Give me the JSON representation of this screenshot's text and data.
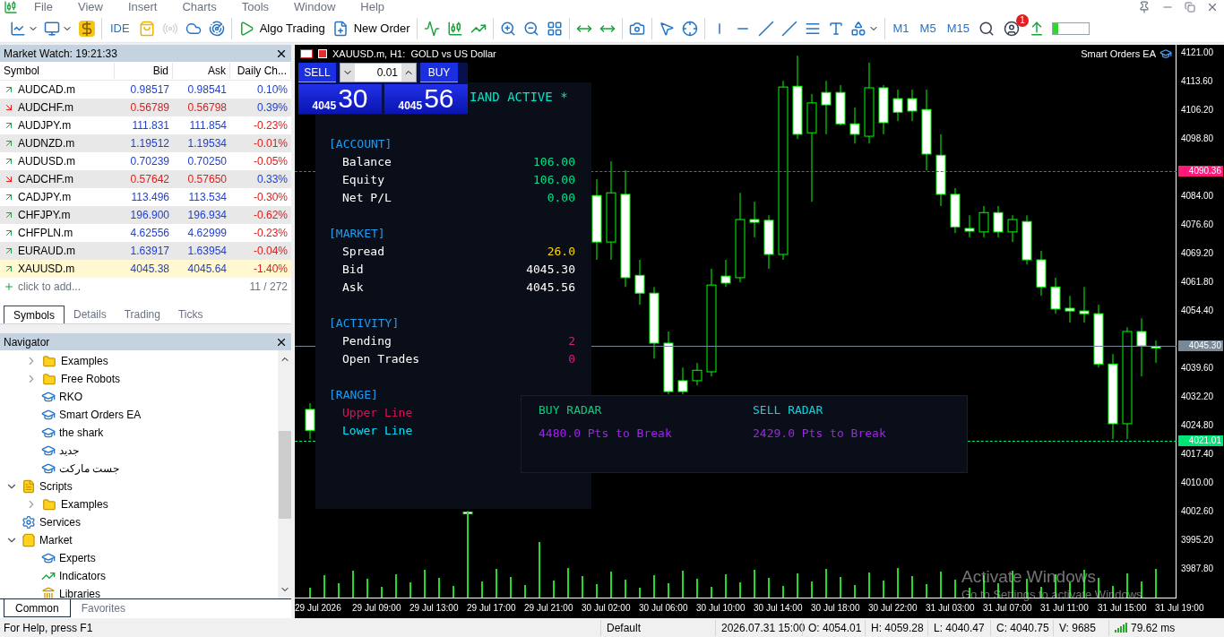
{
  "menu": [
    "File",
    "View",
    "Insert",
    "Charts",
    "Tools",
    "Window",
    "Help"
  ],
  "toolbar": {
    "ide": "IDE",
    "algo_trading": "Algo Trading",
    "new_order": "New Order",
    "timeframes": [
      "M1",
      "M5",
      "M15"
    ],
    "notification_count": "1"
  },
  "market_watch": {
    "title": "Market Watch: 19:21:33",
    "columns": [
      "Symbol",
      "Bid",
      "Ask",
      "Daily Ch..."
    ],
    "rows": [
      {
        "symbol": "AUDCAD.m",
        "bid": "0.98517",
        "ask": "0.98541",
        "change": "0.10%",
        "rising": true,
        "change_positive": true,
        "selected": false
      },
      {
        "symbol": "AUDCHF.m",
        "bid": "0.56789",
        "ask": "0.56798",
        "change": "0.39%",
        "rising": false,
        "change_positive": true,
        "selected": false
      },
      {
        "symbol": "AUDJPY.m",
        "bid": "111.831",
        "ask": "111.854",
        "change": "-0.23%",
        "rising": true,
        "change_positive": false,
        "selected": false
      },
      {
        "symbol": "AUDNZD.m",
        "bid": "1.19512",
        "ask": "1.19534",
        "change": "-0.01%",
        "rising": true,
        "change_positive": false,
        "selected": false
      },
      {
        "symbol": "AUDUSD.m",
        "bid": "0.70239",
        "ask": "0.70250",
        "change": "-0.05%",
        "rising": true,
        "change_positive": false,
        "selected": false
      },
      {
        "symbol": "CADCHF.m",
        "bid": "0.57642",
        "ask": "0.57650",
        "change": "0.33%",
        "rising": false,
        "change_positive": true,
        "selected": false
      },
      {
        "symbol": "CADJPY.m",
        "bid": "113.496",
        "ask": "113.534",
        "change": "-0.30%",
        "rising": true,
        "change_positive": false,
        "selected": false
      },
      {
        "symbol": "CHFJPY.m",
        "bid": "196.900",
        "ask": "196.934",
        "change": "-0.62%",
        "rising": true,
        "change_positive": false,
        "selected": false
      },
      {
        "symbol": "CHFPLN.m",
        "bid": "4.62556",
        "ask": "4.62999",
        "change": "-0.23%",
        "rising": true,
        "change_positive": false,
        "selected": false
      },
      {
        "symbol": "EURAUD.m",
        "bid": "1.63917",
        "ask": "1.63954",
        "change": "-0.04%",
        "rising": true,
        "change_positive": false,
        "selected": false
      },
      {
        "symbol": "XAUUSD.m",
        "bid": "4045.38",
        "ask": "4045.64",
        "change": "-1.40%",
        "rising": true,
        "change_positive": false,
        "selected": true
      }
    ],
    "add_hint": "click to add...",
    "count": "11 / 272",
    "tabs": [
      {
        "label": "Symbols",
        "selected": true
      },
      {
        "label": "Details",
        "selected": false
      },
      {
        "label": "Trading",
        "selected": false
      },
      {
        "label": "Ticks",
        "selected": false
      }
    ]
  },
  "navigator": {
    "title": "Navigator",
    "tree": [
      {
        "kind": "group",
        "children": [
          {
            "label": "Examples",
            "kind": "folder",
            "expanded": false
          },
          {
            "label": "Free Robots",
            "kind": "folder",
            "expanded": false
          },
          {
            "label": "RKO",
            "kind": "expert"
          },
          {
            "label": "Smart Orders EA",
            "kind": "expert"
          },
          {
            "label": "the shark",
            "kind": "expert"
          },
          {
            "label": "جديد",
            "kind": "expert"
          },
          {
            "label": "جست ماركت",
            "kind": "expert"
          }
        ]
      },
      {
        "label": "Scripts",
        "kind": "scripts",
        "expanded": true,
        "children": [
          {
            "label": "Examples",
            "kind": "folder",
            "expanded": false
          }
        ]
      },
      {
        "label": "Services",
        "kind": "services"
      },
      {
        "label": "Market",
        "kind": "market",
        "expanded": true,
        "children": [
          {
            "label": "Experts",
            "kind": "expert"
          },
          {
            "label": "Indicators",
            "kind": "indicator"
          },
          {
            "label": "Libraries",
            "kind": "library"
          }
        ]
      }
    ],
    "tabs": [
      {
        "label": "Common",
        "selected": true
      },
      {
        "label": "Favorites",
        "selected": false
      }
    ]
  },
  "chart": {
    "title": "XAUUSD.m, H1:  GOLD vs US Dollar",
    "expert": "Smart Orders EA",
    "chart_data": {
      "type": "candlestick",
      "ylim": [
        3980.2,
        4123.1
      ],
      "categories": [
        null,
        null,
        "29 Jul 2026",
        null,
        null,
        null,
        "29 Jul 09:00",
        null,
        null,
        null,
        "29 Jul 13:00",
        null,
        null,
        null,
        "29 Jul 17:00",
        null,
        null,
        null,
        "29 Jul 21:00",
        null,
        null,
        null,
        "30 Jul 02:00",
        null,
        null,
        null,
        "30 Jul 06:00",
        null,
        null,
        null,
        "30 Jul 10:00",
        null,
        null,
        null,
        "30 Jul 14:00",
        null,
        null,
        null,
        "30 Jul 18:00",
        null,
        null,
        null,
        "30 Jul 22:00",
        null,
        null,
        null,
        "31 Jul 03:00",
        null,
        null,
        null,
        "31 Jul 07:00",
        null,
        null,
        null,
        "31 Jul 11:00",
        null,
        null,
        null,
        "31 Jul 15:00",
        null,
        null,
        null,
        "31 Jul 19:00"
      ],
      "ohlc": [
        null,
        [
          4029.0,
          4030.6,
          4021.3,
          4023.6
        ],
        null,
        null,
        null,
        null,
        null,
        null,
        null,
        null,
        null,
        null,
        [
          4002.5,
          4002.8,
          3995.9,
          4002.2
        ],
        null,
        null,
        null,
        null,
        null,
        null,
        null,
        null,
        [
          4084.2,
          4088.4,
          4067.6,
          4072.2
        ],
        [
          4072.2,
          4093.0,
          4067.6,
          4084.9
        ],
        [
          4084.5,
          4090.7,
          4060.6,
          4063.0
        ],
        [
          4063.6,
          4067.6,
          4056.0,
          4059.0
        ],
        [
          4059.0,
          4060.6,
          4042.1,
          4046.1
        ],
        [
          4046.1,
          4049.1,
          4032.9,
          4033.6
        ],
        [
          4036.4,
          4039.8,
          4032.9,
          4033.6
        ],
        [
          4036.4,
          4041.0,
          4035.2,
          4039.1
        ],
        [
          4038.7,
          4065.3,
          4037.5,
          4061.1
        ],
        [
          4063.4,
          4067.6,
          4060.6,
          4061.6
        ],
        [
          4063.0,
          4084.9,
          4061.8,
          4078.0
        ],
        [
          4078.0,
          4082.6,
          4073.4,
          4077.3
        ],
        [
          4077.8,
          4079.1,
          4065.3,
          4069.0
        ],
        [
          4069.0,
          4113.8,
          4067.6,
          4112.2
        ],
        [
          4112.4,
          4120.3,
          4098.8,
          4100.0
        ],
        [
          4100.4,
          4110.4,
          4082.6,
          4108.1
        ],
        [
          4110.8,
          4113.8,
          4100.0,
          4107.6
        ],
        [
          4110.8,
          4112.7,
          4102.3,
          4102.7
        ],
        [
          4102.7,
          4106.9,
          4097.6,
          4100.0
        ],
        [
          4099.5,
          4118.5,
          4097.6,
          4112.0
        ],
        [
          4112.0,
          4112.7,
          4100.0,
          4103.0
        ],
        [
          4109.2,
          4111.5,
          4103.4,
          4105.7
        ],
        [
          4109.2,
          4111.5,
          4103.4,
          4106.0
        ],
        [
          4106.4,
          4111.5,
          4090.7,
          4094.9
        ],
        [
          4094.6,
          4100.0,
          4081.5,
          4084.5
        ],
        [
          4084.5,
          4086.1,
          4074.5,
          4076.1
        ],
        [
          4075.7,
          4079.1,
          4073.4,
          4075.0
        ],
        [
          4074.8,
          4081.5,
          4073.4,
          4079.8
        ],
        [
          4079.8,
          4081.5,
          4073.4,
          4074.8
        ],
        [
          4074.8,
          4079.1,
          4072.2,
          4078.0
        ],
        [
          4077.5,
          4079.1,
          4066.4,
          4067.6
        ],
        [
          4067.6,
          4069.9,
          4058.3,
          4060.6
        ],
        [
          4060.6,
          4063.0,
          4053.7,
          4054.9
        ],
        [
          4055.1,
          4058.3,
          4051.4,
          4054.4
        ],
        [
          4054.4,
          4060.6,
          4051.4,
          4053.7
        ],
        [
          4053.7,
          4056.0,
          4039.8,
          4040.7
        ],
        [
          4040.7,
          4043.3,
          4021.3,
          4025.3
        ],
        [
          4025.3,
          4050.2,
          4021.3,
          4049.1
        ],
        [
          4049.1,
          4052.5,
          4037.5,
          4045.4
        ],
        [
          4045.3,
          4046.8,
          4041.0,
          4045.3
        ],
        null,
        null
      ],
      "yticks": [
        {
          "value": 4121.0,
          "label": "4121.00"
        },
        {
          "value": 4113.6,
          "label": "4113.60"
        },
        {
          "value": 4106.2,
          "label": "4106.20"
        },
        {
          "value": 4098.8,
          "label": "4098.80"
        },
        {
          "value": 4084.0,
          "label": "4084.00"
        },
        {
          "value": 4076.6,
          "label": "4076.60"
        },
        {
          "value": 4069.2,
          "label": "4069.20"
        },
        {
          "value": 4061.8,
          "label": "4061.80"
        },
        {
          "value": 4054.4,
          "label": "4054.40"
        },
        {
          "value": 4039.6,
          "label": "4039.60"
        },
        {
          "value": 4032.2,
          "label": "4032.20"
        },
        {
          "value": 4024.8,
          "label": "4024.80"
        },
        {
          "value": 4017.4,
          "label": "4017.40"
        },
        {
          "value": 4010.0,
          "label": "4010.00"
        },
        {
          "value": 4002.6,
          "label": "4002.60"
        },
        {
          "value": 3995.2,
          "label": "3995.20"
        },
        {
          "value": 3987.8,
          "label": "3987.80"
        }
      ]
    },
    "price_lines": [
      {
        "label": "4090.36",
        "color": "#ff1a7a",
        "dashed": true
      },
      {
        "label": "4045.30",
        "color": "#778899",
        "dashed": false
      },
      {
        "label": "4021.01",
        "color": "#00e676",
        "dashed": true
      }
    ],
    "trade_panel": {
      "sell": "SELL",
      "buy": "BUY",
      "lot": "0.01",
      "sell_price": {
        "big": "4045",
        "pips": "30"
      },
      "buy_price": {
        "big": "4045",
        "pips": "56"
      }
    },
    "info_panel": {
      "header": "IAND ACTIVE *",
      "sections": [
        {
          "title": "[ACCOUNT]",
          "rows": [
            {
              "label": "Balance",
              "value": "106.00",
              "color": "#00e08a"
            },
            {
              "label": "Equity",
              "value": "106.00",
              "color": "#00e08a"
            },
            {
              "label": "Net P/L",
              "value": "0.00",
              "color": "#00e08a"
            }
          ]
        },
        {
          "title": "[MARKET]",
          "rows": [
            {
              "label": "Spread",
              "value": "26.0",
              "color": "#ffd700"
            },
            {
              "label": "Bid",
              "value": "4045.30",
              "color": "#ffffff"
            },
            {
              "label": "Ask",
              "value": "4045.56",
              "color": "#ffffff"
            }
          ]
        },
        {
          "title": "[ACTIVITY]",
          "rows": [
            {
              "label": "Pending",
              "value": "2",
              "color": "#d0207f"
            },
            {
              "label": "Open Trades",
              "value": "0",
              "color": "#d0207f"
            }
          ]
        },
        {
          "title": "[RANGE]",
          "rows": [
            {
              "label": "Upper Line",
              "color": "#e0105a"
            },
            {
              "label": "Lower Line",
              "color": "#00e5ff"
            }
          ]
        }
      ]
    },
    "radar": [
      {
        "title": "BUY RADAR",
        "color": "#00d07a",
        "value": "4480.0 Pts to Break"
      },
      {
        "title": "SELL RADAR",
        "color": "#00d7e0",
        "value": "2429.0 Pts to Break"
      }
    ],
    "activation": {
      "title": "Activate Windows",
      "subtitle": "Go to Settings to activate Windows."
    }
  },
  "status_bar": {
    "help": "For Help, press F1",
    "profile": "Default",
    "time": "2026.07.31 15:00",
    "open": "O: 4054.01",
    "high": "H: 4059.28",
    "low": "L: 4040.47",
    "close": "C: 4040.75",
    "volume": "V: 9685",
    "ping": "79.62 ms"
  }
}
